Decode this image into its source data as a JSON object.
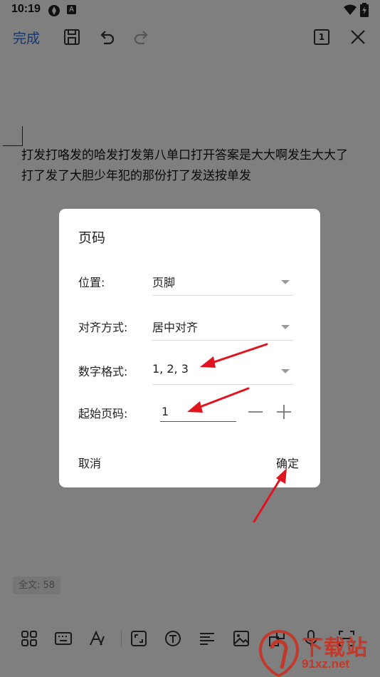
{
  "status_bar": {
    "time": "10:19",
    "badge_letter": "A"
  },
  "toolbar": {
    "done_label": "完成",
    "page_indicator": "1"
  },
  "document": {
    "lines": [
      "打发打咯发的哈发打发第八单口打开答案是大大啊发生大大了",
      "打了发了大胆少年犯的那份打了发送按单发"
    ],
    "word_count": "全文: 58"
  },
  "dialog": {
    "title": "页码",
    "position": {
      "label": "位置:",
      "value": "页脚"
    },
    "alignment": {
      "label": "对齐方式:",
      "value": "居中对齐"
    },
    "number_format": {
      "label": "数字格式:",
      "value": "1, 2, 3"
    },
    "start_page": {
      "label": "起始页码:",
      "value": "1"
    },
    "cancel_label": "取消",
    "ok_label": "确定"
  },
  "watermark": {
    "big": "下载站",
    "small": "91xz.net"
  },
  "colors": {
    "accent": "#2f6fd6",
    "annotation": "#e0141e",
    "watermark": "#c0392b"
  }
}
